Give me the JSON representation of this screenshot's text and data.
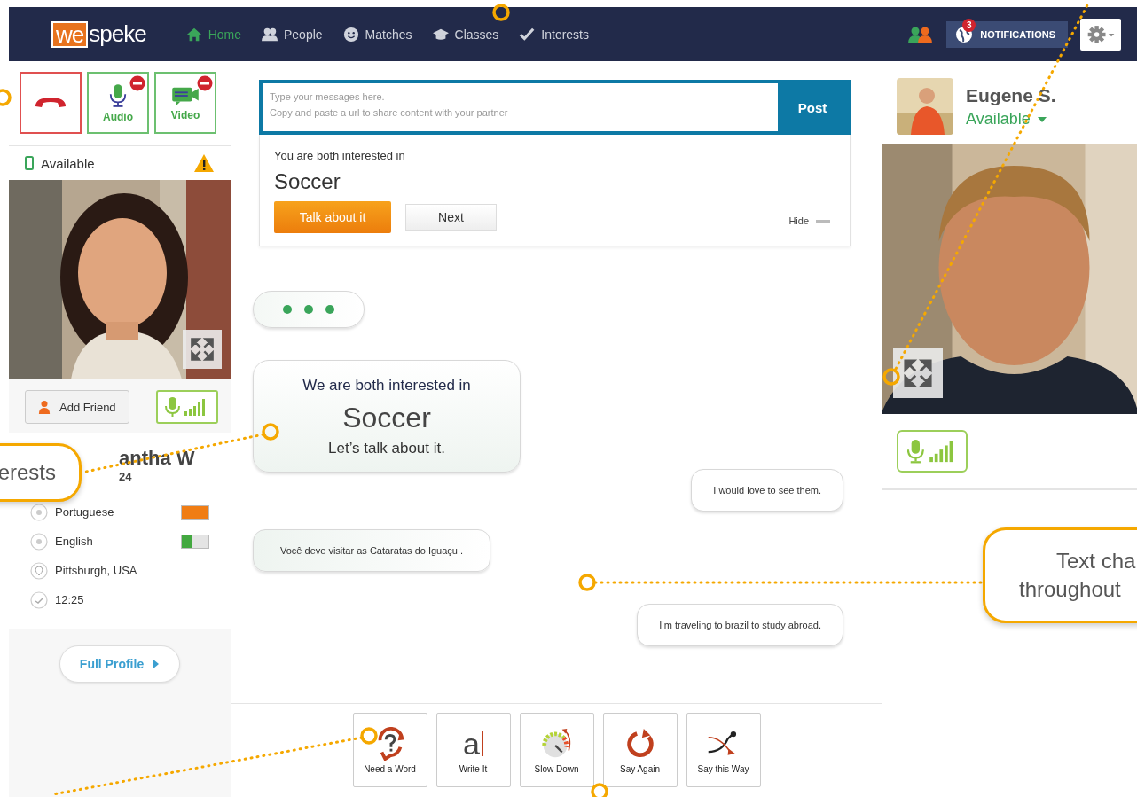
{
  "nav": {
    "logo_a": "we",
    "logo_b": "speke",
    "items": [
      {
        "label": "Home",
        "selected": true
      },
      {
        "label": "People",
        "selected": false
      },
      {
        "label": "Matches",
        "selected": false
      },
      {
        "label": "Classes",
        "selected": false
      },
      {
        "label": "Interests",
        "selected": false
      }
    ],
    "notifications": {
      "count": "3",
      "label": "NOTIFICATIONS"
    }
  },
  "left": {
    "call_buttons": [
      {
        "kind": "hangup"
      },
      {
        "kind": "audio",
        "label": "Audio",
        "muted": true
      },
      {
        "kind": "video",
        "label": "Video",
        "muted": true
      }
    ],
    "status": "Available",
    "warning": true,
    "add_friend": "Add Friend",
    "name": "antha W",
    "age": "24",
    "details": [
      {
        "kind": "language",
        "text": "Portuguese",
        "level": 1,
        "color": "#f07d14"
      },
      {
        "kind": "language",
        "text": "English",
        "level": 0.4,
        "color": "#43a840"
      },
      {
        "kind": "location",
        "text": "Pittsburgh, USA"
      },
      {
        "kind": "time",
        "text": "12:25"
      }
    ],
    "full_profile": "Full Profile"
  },
  "composer": {
    "placeholder": "Type your messages here.\nCopy and paste a url to share content with your partner",
    "post": "Post"
  },
  "suggestion": {
    "intro": "You are both interested in",
    "topic": "Soccer",
    "primary": "Talk about it",
    "secondary": "Next",
    "hide": "Hide"
  },
  "messages": [
    {
      "kind": "typing"
    },
    {
      "kind": "topic",
      "intro": "We are both interested in",
      "topic": "Soccer",
      "prompt": "Let’s talk about it."
    },
    {
      "kind": "sent",
      "text": "I would love to see them."
    },
    {
      "kind": "received",
      "text": "Você deve visitar as Cataratas do Iguaçu ."
    },
    {
      "kind": "sent",
      "text": "I’m traveling to brazil to study abroad."
    }
  ],
  "tools": [
    {
      "label": "Need a Word"
    },
    {
      "label": "Write It",
      "glyph": "a"
    },
    {
      "label": "Slow Down"
    },
    {
      "label": "Say Again"
    },
    {
      "label": "Say this Way"
    }
  ],
  "partner": {
    "name": "Eugene S.",
    "status": "Available"
  },
  "callouts": [
    {
      "lines": [
        "erests"
      ]
    },
    {
      "lines": [
        "Text cha",
        "throughout"
      ]
    }
  ]
}
